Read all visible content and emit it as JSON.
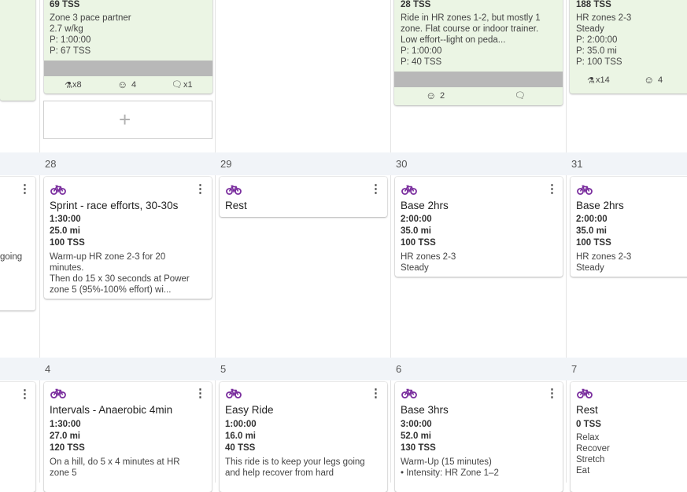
{
  "top_row": {
    "card_a": {
      "tss": "69 TSS",
      "desc": [
        "Zone 3 pace partner",
        "2.7 w/kg",
        "P: 1:00:00",
        "P: 67 TSS"
      ],
      "footer": {
        "strength_count": "x8",
        "smile_count": "4",
        "comment_count": "x1"
      }
    },
    "card_b": {
      "tss": "28 TSS",
      "desc": [
        "Ride in HR zones 1-2, but mostly 1",
        "zone. Flat course or indoor trainer.",
        "Low effort--light on peda...",
        "P: 1:00:00",
        "P: 40 TSS"
      ],
      "footer": {
        "smile_count": "2"
      }
    },
    "card_c": {
      "tss": "188 TSS",
      "desc": [
        "HR zones 2-3",
        "Steady",
        "P: 2:00:00",
        "P: 35.0 mi",
        "P: 100 TSS"
      ],
      "footer": {
        "strength_count": "x14",
        "smile_count": "4"
      }
    }
  },
  "week1": {
    "days": [
      "28",
      "29",
      "30",
      "31"
    ],
    "left_partial": "going",
    "workouts": [
      {
        "title": "Sprint - race efforts, 30-30s",
        "duration": "1:30:00",
        "distance": "25.0 mi",
        "tss": "100 TSS",
        "desc": [
          "Warm-up HR zone 2-3 for 20",
          "minutes.",
          "Then do 15 x 30 seconds at Power",
          "zone 5 (95%-100% effort) wi..."
        ]
      },
      {
        "title": "Rest"
      },
      {
        "title": "Base 2hrs",
        "duration": "2:00:00",
        "distance": "35.0 mi",
        "tss": "100 TSS",
        "desc": [
          "HR zones 2-3",
          "Steady"
        ]
      },
      {
        "title": "Base 2hrs",
        "duration": "2:00:00",
        "distance": "35.0 mi",
        "tss": "100 TSS",
        "desc": [
          "HR zones 2-3",
          "Steady"
        ]
      }
    ]
  },
  "week2": {
    "days": [
      "4",
      "5",
      "6",
      "7"
    ],
    "workouts": [
      {
        "title": "Intervals - Anaerobic 4min",
        "duration": "1:30:00",
        "distance": "27.0 mi",
        "tss": "120 TSS",
        "desc": [
          "On a hill, do 5 x 4 minutes at HR",
          "zone 5"
        ]
      },
      {
        "title": "Easy Ride",
        "duration": "1:00:00",
        "distance": "16.0 mi",
        "tss": "40 TSS",
        "desc": [
          "This ride is to keep your legs going",
          "and help recover from hard"
        ]
      },
      {
        "title": "Base 3hrs",
        "duration": "3:00:00",
        "distance": "52.0 mi",
        "tss": "130 TSS",
        "desc": [
          "Warm-Up (15 minutes)",
          "• Intensity: HR Zone 1–2"
        ]
      },
      {
        "title": "Rest",
        "tss": "0 TSS",
        "desc": [
          "Relax",
          "Recover",
          "Stretch",
          "Eat"
        ]
      }
    ]
  },
  "colors": {
    "completed_card": "#ebf5e4",
    "bike_icon": "#7a2e9e",
    "week_band": "#f1f4f8"
  }
}
